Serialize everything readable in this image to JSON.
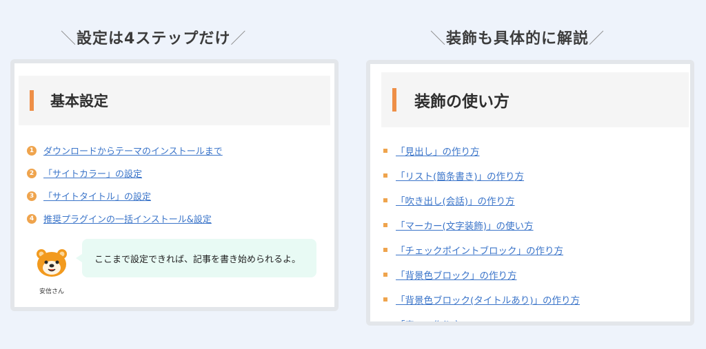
{
  "left": {
    "heading": "設定は4ステップだけ",
    "title": "基本設定",
    "steps": [
      {
        "num": "1",
        "label": "ダウンロードからテーマのインストールまで"
      },
      {
        "num": "2",
        "label": "「サイトカラー」の設定"
      },
      {
        "num": "3",
        "label": "「サイトタイトル」の設定"
      },
      {
        "num": "4",
        "label": "推奨プラグインの一括インストール&設定"
      }
    ],
    "speaker_name": "安信さん",
    "bubble_text": "ここまで設定できれば、記事を書き始められるよ。"
  },
  "right": {
    "heading": "装飾も具体的に解説",
    "title": "装飾の使い方",
    "items": [
      "「見出し」の作り方",
      "「リスト(箇条書き)」の作り方",
      "「吹き出し(会話)」の作り方",
      "「マーカー(文字装飾)」の使い方",
      "「チェックポイントブロック」の作り方",
      "「背景色ブロック」の作り方",
      "「背景色ブロック(タイトルあり)」の作り方",
      "「表」の作り方"
    ]
  },
  "colors": {
    "accent": "#ee8f47",
    "link": "#3a74c9",
    "bubble": "#e8faf4",
    "background": "#eef3fb"
  },
  "icons": {
    "avatar": "bear-avatar-icon",
    "bullet": "orange-square-bullet-icon",
    "number": "orange-number-circle-icon"
  }
}
